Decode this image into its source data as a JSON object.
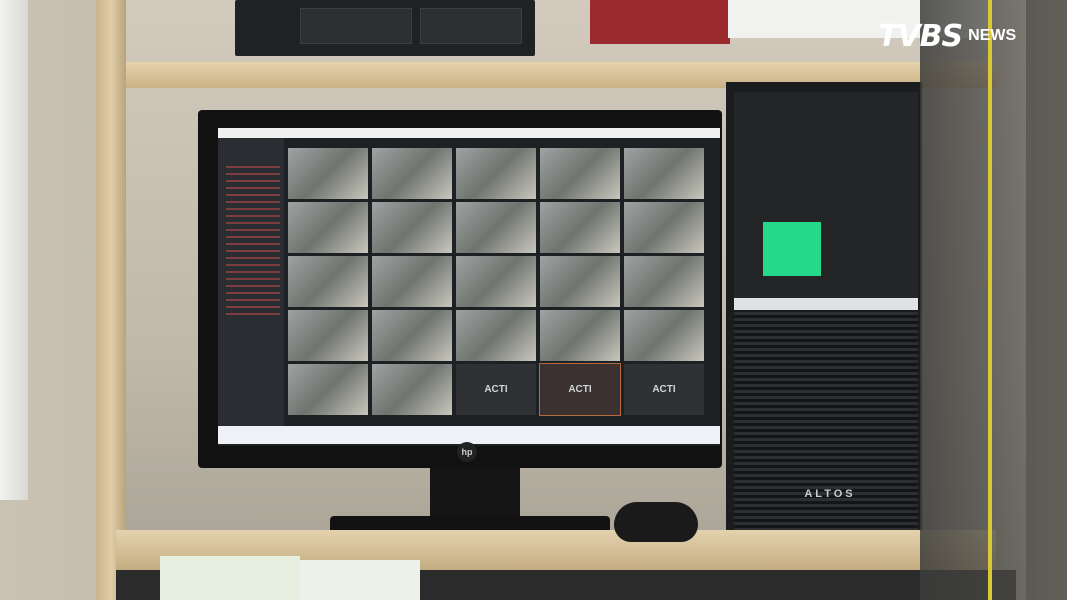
{
  "watermark": {
    "brand": "TVBS",
    "suffix": "NEWS"
  },
  "monitor": {
    "brand": "hp"
  },
  "nvr_software": {
    "tile_label": "ACTI",
    "grid_rows": 5,
    "grid_cols": 5
  },
  "pc_tower": {
    "brand": "ALTOS"
  },
  "colors": {
    "sticky_note": "#25d98a",
    "cable": "#d9c934",
    "brand_text": "#ffffff"
  }
}
